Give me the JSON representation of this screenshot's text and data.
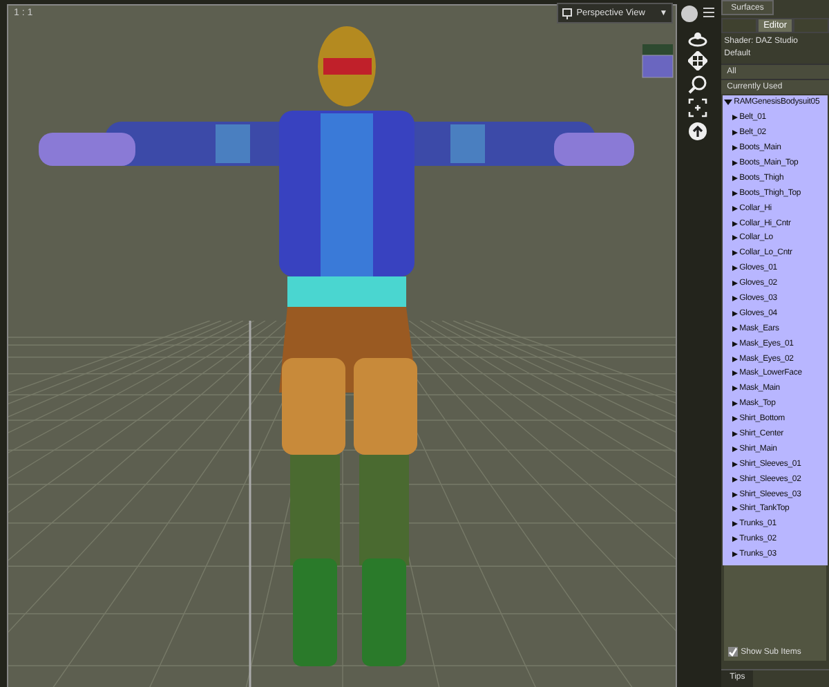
{
  "viewport": {
    "zoom_label": "1 : 1",
    "view_menu": {
      "label": "Perspective View",
      "caret": "▼"
    }
  },
  "panel": {
    "title": "Surfaces",
    "tabs": [
      {
        "selected": false
      },
      {
        "label": "Editor",
        "selected": true
      },
      {
        "selected": false
      }
    ],
    "shader": "Shader: DAZ Studio Default",
    "filters": [
      {
        "label": "All",
        "selected": false
      },
      {
        "label": "Currently Used",
        "selected": false
      }
    ],
    "tree": [
      {
        "label": "RAMGenesisBodysuit05",
        "expanded": true,
        "children": [
          {
            "label": "Belt_01",
            "expanded": false
          },
          {
            "label": "Belt_02",
            "expanded": false
          },
          {
            "label": "Boots_Main",
            "expanded": false
          },
          {
            "label": "Boots_Main_Top",
            "expanded": false
          },
          {
            "label": "Boots_Thigh",
            "expanded": false
          },
          {
            "label": "Boots_Thigh_Top",
            "expanded": false
          },
          {
            "label": "Collar_Hi",
            "expanded": false
          },
          {
            "label": "Collar_Hi_Cntr",
            "expanded": false
          },
          {
            "label": "Collar_Lo",
            "expanded": false
          },
          {
            "label": "Collar_Lo_Cntr",
            "expanded": false
          },
          {
            "label": "Gloves_01",
            "expanded": false
          },
          {
            "label": "Gloves_02",
            "expanded": false
          },
          {
            "label": "Gloves_03",
            "expanded": false
          },
          {
            "label": "Gloves_04",
            "expanded": false
          },
          {
            "label": "Mask_Ears",
            "expanded": false
          },
          {
            "label": "Mask_Eyes_01",
            "expanded": false
          },
          {
            "label": "Mask_Eyes_02",
            "expanded": false
          },
          {
            "label": "Mask_LowerFace",
            "expanded": false
          },
          {
            "label": "Mask_Main",
            "expanded": false
          },
          {
            "label": "Mask_Top",
            "expanded": false
          },
          {
            "label": "Shirt_Bottom",
            "expanded": false
          },
          {
            "label": "Shirt_Center",
            "expanded": false
          },
          {
            "label": "Shirt_Main",
            "expanded": false
          },
          {
            "label": "Shirt_Sleeves_01",
            "expanded": false
          },
          {
            "label": "Shirt_Sleeves_02",
            "expanded": false
          },
          {
            "label": "Shirt_Sleeves_03",
            "expanded": false
          },
          {
            "label": "Shirt_TankTop",
            "expanded": false
          },
          {
            "label": "Trunks_01",
            "expanded": false
          },
          {
            "label": "Trunks_02",
            "expanded": false
          },
          {
            "label": "Trunks_03",
            "expanded": false
          }
        ]
      }
    ],
    "show_sub_items": {
      "label": "Show Sub Items",
      "checked": true
    },
    "bottom_tab": "Tips"
  }
}
